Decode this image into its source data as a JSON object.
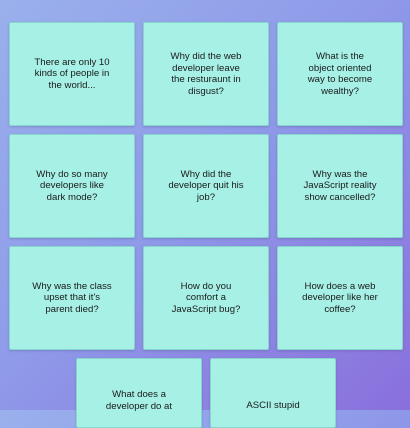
{
  "cards": [
    {
      "text": "There are only 10 kinds of people in the world..."
    },
    {
      "text": "Why did the web developer leave the resturaunt in disgust?"
    },
    {
      "text": "What is the object oriented way to become wealthy?"
    },
    {
      "text": "Why do so many developers like dark mode?"
    },
    {
      "text": "Why did the developer quit his job?"
    },
    {
      "text": "Why was the JavaScript reality show cancelled?"
    },
    {
      "text": "Why was the class upset that it's parent died?"
    },
    {
      "text": "How do you comfort a JavaScript bug?"
    },
    {
      "text": "How does a web developer like her coffee?"
    },
    {
      "text": "What does a developer do at"
    },
    {
      "text": "ASCII stupid"
    }
  ]
}
